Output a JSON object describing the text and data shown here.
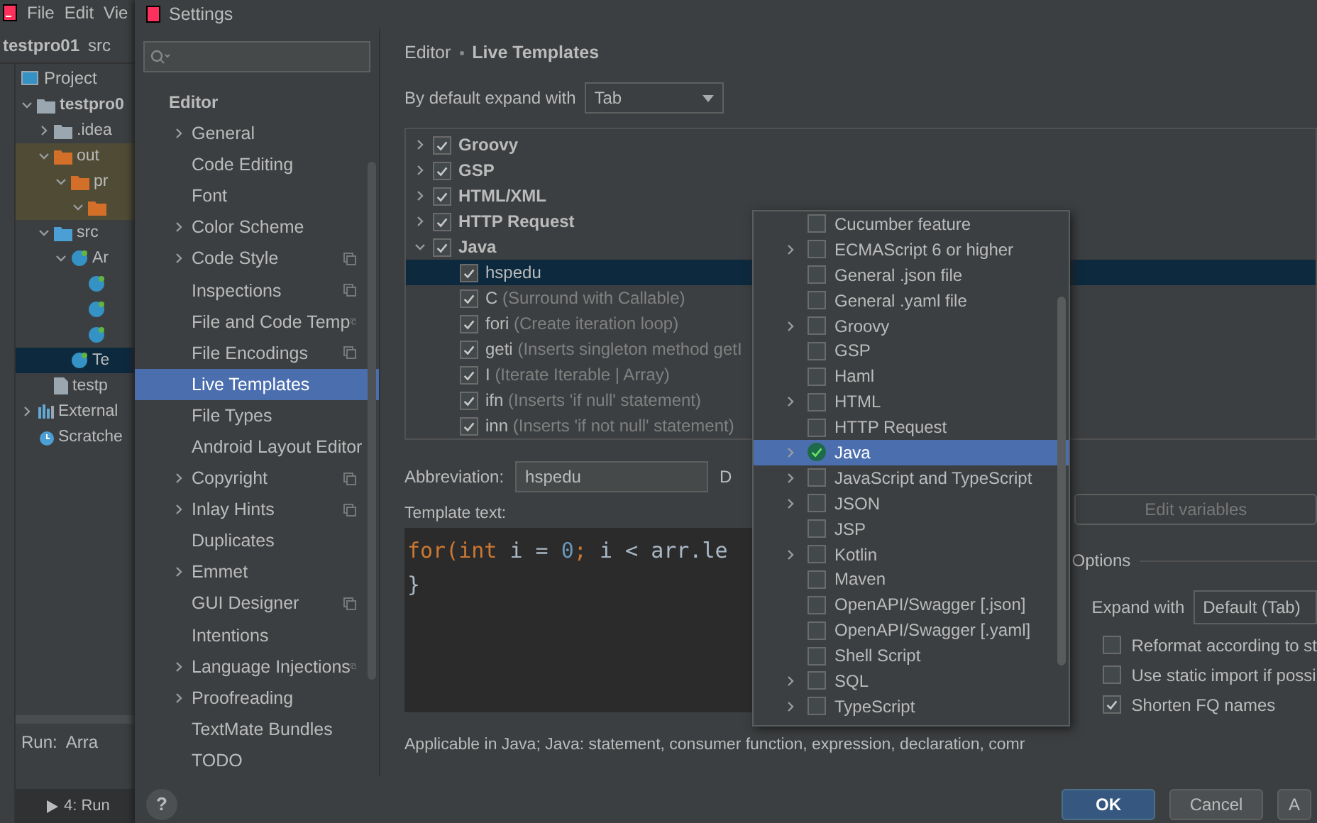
{
  "ide": {
    "menu": [
      "File",
      "Edit",
      "Vie"
    ],
    "breadcrumb": [
      "testpro01",
      "src"
    ],
    "project_header": "Project",
    "tree": [
      {
        "label": "testpro0",
        "kind": "module",
        "expanded": true,
        "selected": false,
        "children": [
          {
            "label": ".idea",
            "kind": "folder",
            "expanded": false,
            "selected": false
          },
          {
            "label": "out",
            "kind": "excluded",
            "expanded": true,
            "selected": false,
            "children": [
              {
                "label": "pr",
                "kind": "excluded",
                "expanded": true,
                "selected": false,
                "children": [
                  {
                    "kind": "excluded",
                    "expanded": true,
                    "selected": false
                  }
                ]
              }
            ]
          },
          {
            "label": "src",
            "kind": "source",
            "expanded": true,
            "selected": false,
            "children": [
              {
                "label": "Ar",
                "kind": "class",
                "expanded": true,
                "selected": false,
                "children": [
                  {
                    "kind": "class",
                    "selected": false
                  },
                  {
                    "kind": "class",
                    "selected": false
                  },
                  {
                    "kind": "class",
                    "selected": false
                  }
                ]
              },
              {
                "label": "Te",
                "kind": "class",
                "selected": true
              }
            ]
          },
          {
            "label": "testp",
            "kind": "file",
            "selected": false
          }
        ]
      },
      {
        "label": "External",
        "kind": "library",
        "expanded": false,
        "selected": false
      },
      {
        "label": "Scratche",
        "kind": "scratch",
        "selected": false
      }
    ],
    "run_label": "Run:",
    "run_tab": "Arra",
    "bottom_tab": "4: Run"
  },
  "dialog": {
    "title": "Settings",
    "nav_header": "Editor",
    "nav": [
      {
        "label": "General",
        "kind": "group",
        "shared": false,
        "selected": false
      },
      {
        "label": "Code Editing",
        "kind": "page",
        "shared": false,
        "selected": false
      },
      {
        "label": "Font",
        "kind": "page",
        "shared": false,
        "selected": false
      },
      {
        "label": "Color Scheme",
        "kind": "group",
        "shared": false,
        "selected": false
      },
      {
        "label": "Code Style",
        "kind": "group",
        "shared": true,
        "selected": false
      },
      {
        "label": "Inspections",
        "kind": "page",
        "shared": true,
        "selected": false
      },
      {
        "label": "File and Code Temp",
        "kind": "page",
        "shared": true,
        "selected": false
      },
      {
        "label": "File Encodings",
        "kind": "page",
        "shared": true,
        "selected": false
      },
      {
        "label": "Live Templates",
        "kind": "page",
        "shared": false,
        "selected": true
      },
      {
        "label": "File Types",
        "kind": "page",
        "shared": false,
        "selected": false
      },
      {
        "label": "Android Layout Editor",
        "kind": "page",
        "shared": false,
        "selected": false
      },
      {
        "label": "Copyright",
        "kind": "group",
        "shared": true,
        "selected": false
      },
      {
        "label": "Inlay Hints",
        "kind": "group",
        "shared": true,
        "selected": false
      },
      {
        "label": "Duplicates",
        "kind": "page",
        "shared": false,
        "selected": false
      },
      {
        "label": "Emmet",
        "kind": "group",
        "shared": false,
        "selected": false
      },
      {
        "label": "GUI Designer",
        "kind": "page",
        "shared": true,
        "selected": false
      },
      {
        "label": "Intentions",
        "kind": "page",
        "shared": false,
        "selected": false
      },
      {
        "label": "Language Injections",
        "kind": "group",
        "shared": true,
        "selected": false
      },
      {
        "label": "Proofreading",
        "kind": "group",
        "shared": false,
        "selected": false
      },
      {
        "label": "TextMate Bundles",
        "kind": "page",
        "shared": false,
        "selected": false
      },
      {
        "label": "TODO",
        "kind": "page",
        "shared": false,
        "selected": false
      }
    ],
    "breadcrumb": [
      "Editor",
      "Live Templates"
    ],
    "expand_label": "By default expand with",
    "expand_value": "Tab",
    "template_groups": [
      {
        "name": "Groovy",
        "checked": true,
        "expanded": false
      },
      {
        "name": "GSP",
        "checked": true,
        "expanded": false
      },
      {
        "name": "HTML/XML",
        "checked": true,
        "expanded": false
      },
      {
        "name": "HTTP Request",
        "checked": true,
        "expanded": false
      },
      {
        "name": "Java",
        "checked": true,
        "expanded": true,
        "children": [
          {
            "abbreviation": "hspedu",
            "checked": true,
            "selected": true
          },
          {
            "abbreviation": "C",
            "description": "(Surround with Callable)",
            "checked": true,
            "selected": false
          },
          {
            "abbreviation": "fori",
            "description": "(Create iteration loop)",
            "checked": true,
            "selected": false
          },
          {
            "abbreviation": "geti",
            "description": "(Inserts singleton method getI",
            "checked": true,
            "selected": false
          },
          {
            "abbreviation": "I",
            "description": "(Iterate Iterable | Array)",
            "checked": true,
            "selected": false
          },
          {
            "abbreviation": "ifn",
            "description": "(Inserts 'if null' statement)",
            "checked": true,
            "selected": false
          },
          {
            "abbreviation": "inn",
            "description": "(Inserts 'if not null' statement)",
            "checked": true,
            "selected": false
          }
        ]
      }
    ],
    "abbreviation_label": "Abbreviation:",
    "abbreviation_value": "hspedu",
    "description_label": "D",
    "template_label": "Template text:",
    "code": [
      [
        {
          "kind": "keyword",
          "text": "for("
        },
        {
          "kind": "keyword",
          "text": "int"
        },
        {
          "kind": "plain",
          "text": " i = "
        },
        {
          "kind": "number",
          "text": "0"
        },
        {
          "kind": "keyword",
          "text": ";"
        },
        {
          "kind": "plain",
          "text": " i < arr.le"
        }
      ],
      [
        {
          "kind": "plain",
          "text": "}"
        }
      ]
    ],
    "applicable": "Applicable in Java; Java: statement, consumer function, expression, declaration, comr",
    "edit_variables": "Edit variables",
    "options_label": "Options",
    "expand_with_label": "Expand with",
    "expand_with_value": "Default (Tab)",
    "options": [
      {
        "label": "Reformat according to st",
        "checked": false
      },
      {
        "label": "Use static import if possi",
        "checked": false
      },
      {
        "label": "Shorten FQ names",
        "checked": true
      }
    ],
    "buttons": [
      {
        "label": "OK",
        "kind": "primary"
      },
      {
        "label": "Cancel",
        "kind": "normal"
      },
      {
        "label": "A",
        "kind": "normal"
      }
    ],
    "help": "?"
  },
  "context_popup": [
    {
      "label": "Cucumber feature",
      "kind": "leaf",
      "checked": false,
      "selected": false
    },
    {
      "label": "ECMAScript 6 or higher",
      "kind": "group",
      "checked": false,
      "selected": false
    },
    {
      "label": "General .json file",
      "kind": "leaf",
      "checked": false,
      "selected": false
    },
    {
      "label": "General .yaml file",
      "kind": "leaf",
      "checked": false,
      "selected": false
    },
    {
      "label": "Groovy",
      "kind": "group",
      "checked": false,
      "selected": false
    },
    {
      "label": "GSP",
      "kind": "leaf",
      "checked": false,
      "selected": false
    },
    {
      "label": "Haml",
      "kind": "leaf",
      "checked": false,
      "selected": false
    },
    {
      "label": "HTML",
      "kind": "group",
      "checked": false,
      "selected": false
    },
    {
      "label": "HTTP Request",
      "kind": "leaf",
      "checked": false,
      "selected": false
    },
    {
      "label": "Java",
      "kind": "group",
      "checked": true,
      "selected": true
    },
    {
      "label": "JavaScript and TypeScript",
      "kind": "group",
      "checked": false,
      "selected": false
    },
    {
      "label": "JSON",
      "kind": "group",
      "checked": false,
      "selected": false
    },
    {
      "label": "JSP",
      "kind": "leaf",
      "checked": false,
      "selected": false
    },
    {
      "label": "Kotlin",
      "kind": "group",
      "checked": false,
      "selected": false
    },
    {
      "label": "Maven",
      "kind": "leaf",
      "checked": false,
      "selected": false
    },
    {
      "label": "OpenAPI/Swagger [.json]",
      "kind": "leaf",
      "checked": false,
      "selected": false
    },
    {
      "label": "OpenAPI/Swagger [.yaml]",
      "kind": "leaf",
      "checked": false,
      "selected": false
    },
    {
      "label": "Shell Script",
      "kind": "leaf",
      "checked": false,
      "selected": false
    },
    {
      "label": "SQL",
      "kind": "group",
      "checked": false,
      "selected": false
    },
    {
      "label": "TypeScript",
      "kind": "group",
      "checked": false,
      "selected": false
    }
  ]
}
